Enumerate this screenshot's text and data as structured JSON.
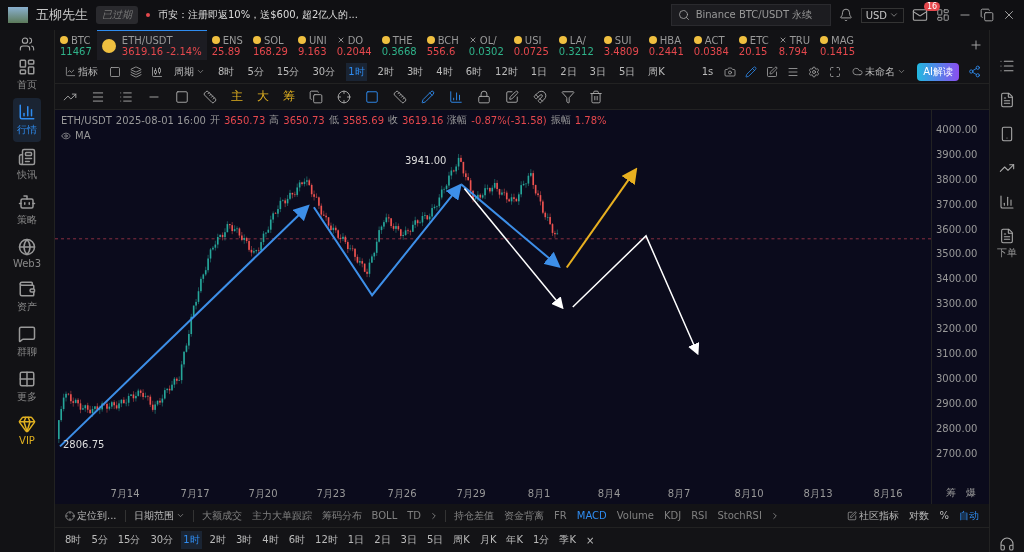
{
  "top_bar": {
    "user": "五柳先生",
    "badge": "已过期",
    "notice": "币安：注册即返10%，送$600, 超2亿人的...",
    "search": {
      "placeholder": "Binance BTC/USDT 永续"
    },
    "currency": "USD",
    "mail_count": "16"
  },
  "sidebar": [
    {
      "label": "首页",
      "selected": false
    },
    {
      "label": "行情",
      "selected": true
    },
    {
      "label": "快讯",
      "selected": false
    },
    {
      "label": "策略",
      "selected": false
    },
    {
      "label": "Web3",
      "selected": false
    },
    {
      "label": "资产",
      "selected": false
    },
    {
      "label": "群聊",
      "selected": false
    },
    {
      "label": "更多",
      "selected": false
    },
    {
      "label": "VIP",
      "selected": false
    }
  ],
  "tickers": [
    {
      "symbol": "BTC",
      "price": "11467",
      "kind": "coin",
      "rising": true,
      "selected": false
    },
    {
      "symbol": "ETH/USDT",
      "price": "3619.16",
      "change": "-2.14%",
      "kind": "coin",
      "rising": false,
      "selected": true
    },
    {
      "symbol": "ENS",
      "price": "25.89",
      "kind": "coin",
      "rising": false,
      "selected": false
    },
    {
      "symbol": "SOL",
      "price": "168.29",
      "kind": "coin",
      "rising": false,
      "selected": false
    },
    {
      "symbol": "UNI",
      "price": "9.163",
      "kind": "coin",
      "rising": false,
      "selected": false
    },
    {
      "symbol": "DO",
      "price": "0.2044",
      "kind": "cross",
      "rising": false,
      "selected": false
    },
    {
      "symbol": "THE",
      "price": "0.3668",
      "kind": "coin",
      "rising": true,
      "selected": false
    },
    {
      "symbol": "BCH",
      "price": "556.6",
      "kind": "coin",
      "rising": false,
      "selected": false
    },
    {
      "symbol": "OL/",
      "price": "0.0302",
      "kind": "cross",
      "rising": true,
      "selected": false
    },
    {
      "symbol": "USI",
      "price": "0.0725",
      "kind": "coin",
      "rising": false,
      "selected": false
    },
    {
      "symbol": "LA/",
      "price": "0.3212",
      "kind": "coin",
      "rising": true,
      "selected": false
    },
    {
      "symbol": "SUI",
      "price": "3.4809",
      "kind": "coin",
      "rising": false,
      "selected": false
    },
    {
      "symbol": "HBA",
      "price": "0.2441",
      "kind": "coin",
      "rising": false,
      "selected": false
    },
    {
      "symbol": "ACT",
      "price": "0.0384",
      "kind": "coin",
      "rising": false,
      "selected": false
    },
    {
      "symbol": "ETC",
      "price": "20.15",
      "kind": "coin",
      "rising": false,
      "selected": false
    },
    {
      "symbol": "TRU",
      "price": "8.794",
      "kind": "cross",
      "rising": false,
      "selected": false
    },
    {
      "symbol": "MAG",
      "price": "0.1415",
      "kind": "coin",
      "rising": false,
      "selected": false
    }
  ],
  "toolbar": {
    "indicator": "指标",
    "period": "周期",
    "intervals": [
      {
        "label": "8时",
        "selected": false
      },
      {
        "label": "5分",
        "selected": false
      },
      {
        "label": "15分",
        "selected": false
      },
      {
        "label": "30分",
        "selected": false
      },
      {
        "label": "1时",
        "selected": true
      },
      {
        "label": "2时",
        "selected": false
      },
      {
        "label": "3时",
        "selected": false
      },
      {
        "label": "4时",
        "selected": false
      },
      {
        "label": "6时",
        "selected": false
      },
      {
        "label": "12时",
        "selected": false
      },
      {
        "label": "1日",
        "selected": false
      },
      {
        "label": "2日",
        "selected": false
      },
      {
        "label": "3日",
        "selected": false
      },
      {
        "label": "5日",
        "selected": false
      },
      {
        "label": "周K",
        "selected": false
      }
    ],
    "speed": "1s",
    "layout_name": "未命名",
    "ai_button": "AI解读"
  },
  "drawing_tools": {
    "labels": [
      "主",
      "大",
      "筹"
    ]
  },
  "chart": {
    "legend": {
      "symbol": "ETH/USDT",
      "time": "2025-08-01 16:00",
      "open_label": "开",
      "open": "3650.73",
      "high_label": "高",
      "high": "3650.73",
      "low_label": "低",
      "low": "3585.69",
      "close_label": "收",
      "close": "3619.16",
      "change_label": "涨幅",
      "change": "-0.87%(-31.58)",
      "amplitude_label": "振幅",
      "amplitude": "1.78%"
    },
    "ma_label": "MA",
    "high_marker": "3941.00",
    "low_marker": "2806.75",
    "price_axis": [
      "4000.00",
      "3900.00",
      "3800.00",
      "3700.00",
      "3600.00",
      "3500.00",
      "3400.00",
      "3300.00",
      "3200.00",
      "3100.00",
      "3000.00",
      "2900.00",
      "2800.00",
      "2700.00"
    ],
    "date_axis": [
      "7月14",
      "7月17",
      "7月20",
      "7月23",
      "7月26",
      "7月29",
      "8月1",
      "8月4",
      "8月7",
      "8月10",
      "8月13",
      "8月16"
    ],
    "axis_buttons": [
      "筹",
      "爆"
    ]
  },
  "indicator_bar": {
    "locate": "定位到...",
    "date_range": "日期范围",
    "indicators": [
      {
        "label": "大额成交",
        "selected": false
      },
      {
        "label": "主力大单跟踪",
        "selected": false
      },
      {
        "label": "筹码分布",
        "selected": false
      },
      {
        "label": "BOLL",
        "selected": false
      },
      {
        "label": "TD",
        "selected": false
      }
    ],
    "sub_indicators": [
      {
        "label": "持仓差值",
        "selected": false
      },
      {
        "label": "资金背离",
        "selected": false
      },
      {
        "label": "FR",
        "selected": false
      },
      {
        "label": "MACD",
        "selected": true
      },
      {
        "label": "Volume",
        "selected": false
      },
      {
        "label": "KDJ",
        "selected": false
      },
      {
        "label": "RSI",
        "selected": false
      },
      {
        "label": "StochRSI",
        "selected": false
      }
    ],
    "community": "社区指标",
    "scale_options": [
      {
        "label": "对数",
        "selected": false
      },
      {
        "label": "%",
        "selected": false
      },
      {
        "label": "自动",
        "selected": true
      }
    ]
  },
  "interval_bar": [
    {
      "label": "8时",
      "selected": false
    },
    {
      "label": "5分",
      "selected": false
    },
    {
      "label": "15分",
      "selected": false
    },
    {
      "label": "30分",
      "selected": false
    },
    {
      "label": "1时",
      "selected": true
    },
    {
      "label": "2时",
      "selected": false
    },
    {
      "label": "3时",
      "selected": false
    },
    {
      "label": "4时",
      "selected": false
    },
    {
      "label": "6时",
      "selected": false
    },
    {
      "label": "12时",
      "selected": false
    },
    {
      "label": "1日",
      "selected": false
    },
    {
      "label": "2日",
      "selected": false
    },
    {
      "label": "3日",
      "selected": false
    },
    {
      "label": "5日",
      "selected": false
    },
    {
      "label": "周K",
      "selected": false
    },
    {
      "label": "月K",
      "selected": false
    },
    {
      "label": "年K",
      "selected": false
    },
    {
      "label": "1分",
      "selected": false
    },
    {
      "label": "季K",
      "selected": false
    }
  ],
  "interval_close": "×",
  "right_sidebar": {
    "order_label": "下单"
  }
}
